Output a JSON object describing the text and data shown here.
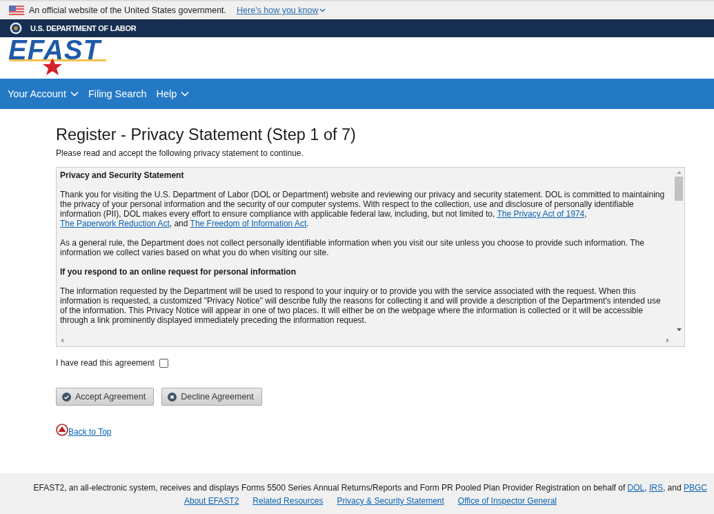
{
  "gov_banner": {
    "text": "An official website of the United States government.",
    "link": "Here's how you know"
  },
  "agency_bar": {
    "name": "U.S. DEPARTMENT OF LABOR"
  },
  "logo": {
    "text": "EFAST"
  },
  "nav": [
    {
      "label": "Your Account",
      "dropdown": true
    },
    {
      "label": "Filing Search",
      "dropdown": false
    },
    {
      "label": "Help",
      "dropdown": true
    }
  ],
  "page": {
    "title": "Register - Privacy Statement (Step 1 of 7)",
    "intro": "Please read and accept the following privacy statement to continue."
  },
  "statement": {
    "blocks": [
      {
        "kind": "heading",
        "text": "Privacy and Security Statement"
      },
      {
        "kind": "paragraph",
        "parts": [
          {
            "text": "Thank you for visiting the U.S. Department of Labor (DOL or Department) website and reviewing our privacy and security statement. DOL is committed to maintaining the privacy of your personal information and the security of our computer systems. With respect to the collection, use and disclosure of personally identifiable information (PII), DOL makes every effort to ensure compliance with applicable federal law, including, but not limited to, ",
            "link": false
          },
          {
            "text": "The Privacy Act of 1974",
            "link": true
          },
          {
            "text": ", ",
            "link": false
          },
          {
            "text": "The Paperwork Reduction Act",
            "link": true
          },
          {
            "text": ", and ",
            "link": false
          },
          {
            "text": "The Freedom of Information Act",
            "link": true
          },
          {
            "text": ".",
            "link": false
          }
        ]
      },
      {
        "kind": "paragraph",
        "parts": [
          {
            "text": "As a general rule, the Department does not collect personally identifiable information when you visit our site unless you choose to provide such information. The information we collect varies based on what you do when visiting our site.",
            "link": false
          }
        ]
      },
      {
        "kind": "heading",
        "text": "If you respond to an online request for personal information"
      },
      {
        "kind": "paragraph",
        "parts": [
          {
            "text": "The information requested by the Department will be used to respond to your inquiry or to provide you with the service associated with the request. When this information is requested, a customized \"Privacy Notice\" will describe fully the reasons for collecting it and will provide a description of the Department's intended use of the information. This Privacy Notice will appear in one of two places. It will either be on the webpage where the information is collected or it will be accessible through a link prominently displayed immediately preceding the information request.",
            "link": false
          }
        ]
      }
    ]
  },
  "agreement": {
    "label": "I have read this agreement",
    "checked": false
  },
  "buttons": [
    {
      "label": "Accept Agreement",
      "kind": "accept"
    },
    {
      "label": "Decline Agreement",
      "kind": "decline"
    }
  ],
  "back_to_top": "Back to Top",
  "footer": {
    "description": [
      {
        "text": "EFAST2, an all-electronic system, receives and displays Forms 5500 Series Annual Returns/Reports and Form PR Pooled Plan Provider Registration on behalf of ",
        "link": false
      },
      {
        "text": "DOL",
        "link": true
      },
      {
        "text": ", ",
        "link": false
      },
      {
        "text": "IRS",
        "link": true
      },
      {
        "text": ", and ",
        "link": false
      },
      {
        "text": "PBGC",
        "link": true
      }
    ],
    "links": [
      "About EFAST2",
      "Related Resources",
      "Privacy & Security Statement",
      "Office of Inspector General"
    ]
  }
}
